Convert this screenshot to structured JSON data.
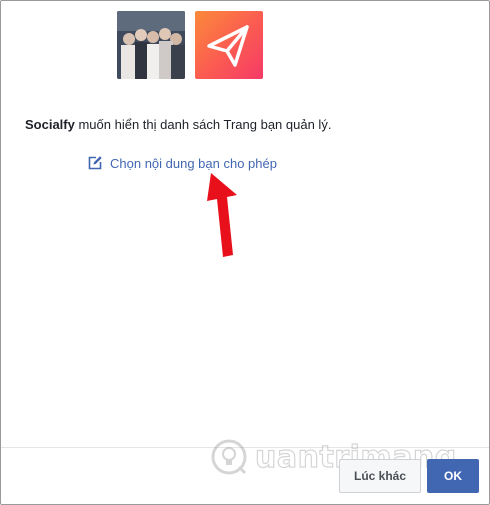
{
  "dialog": {
    "message_app_name": "Socialfy",
    "message_text": " muốn hiển thị danh sách Trang bạn quản lý.",
    "edit_link_label": "Chọn nội dung bạn cho phép"
  },
  "avatars": {
    "user_icon": "user-photo",
    "app_icon": "paper-plane-icon"
  },
  "footer": {
    "later_label": "Lúc khác",
    "ok_label": "OK"
  },
  "watermark": {
    "text": "uantrimang"
  },
  "colors": {
    "link": "#4267b2",
    "primary_button": "#4267b2",
    "arrow": "#e8101b",
    "app_gradient_start": "#fb8a3a",
    "app_gradient_end": "#f53a67"
  }
}
